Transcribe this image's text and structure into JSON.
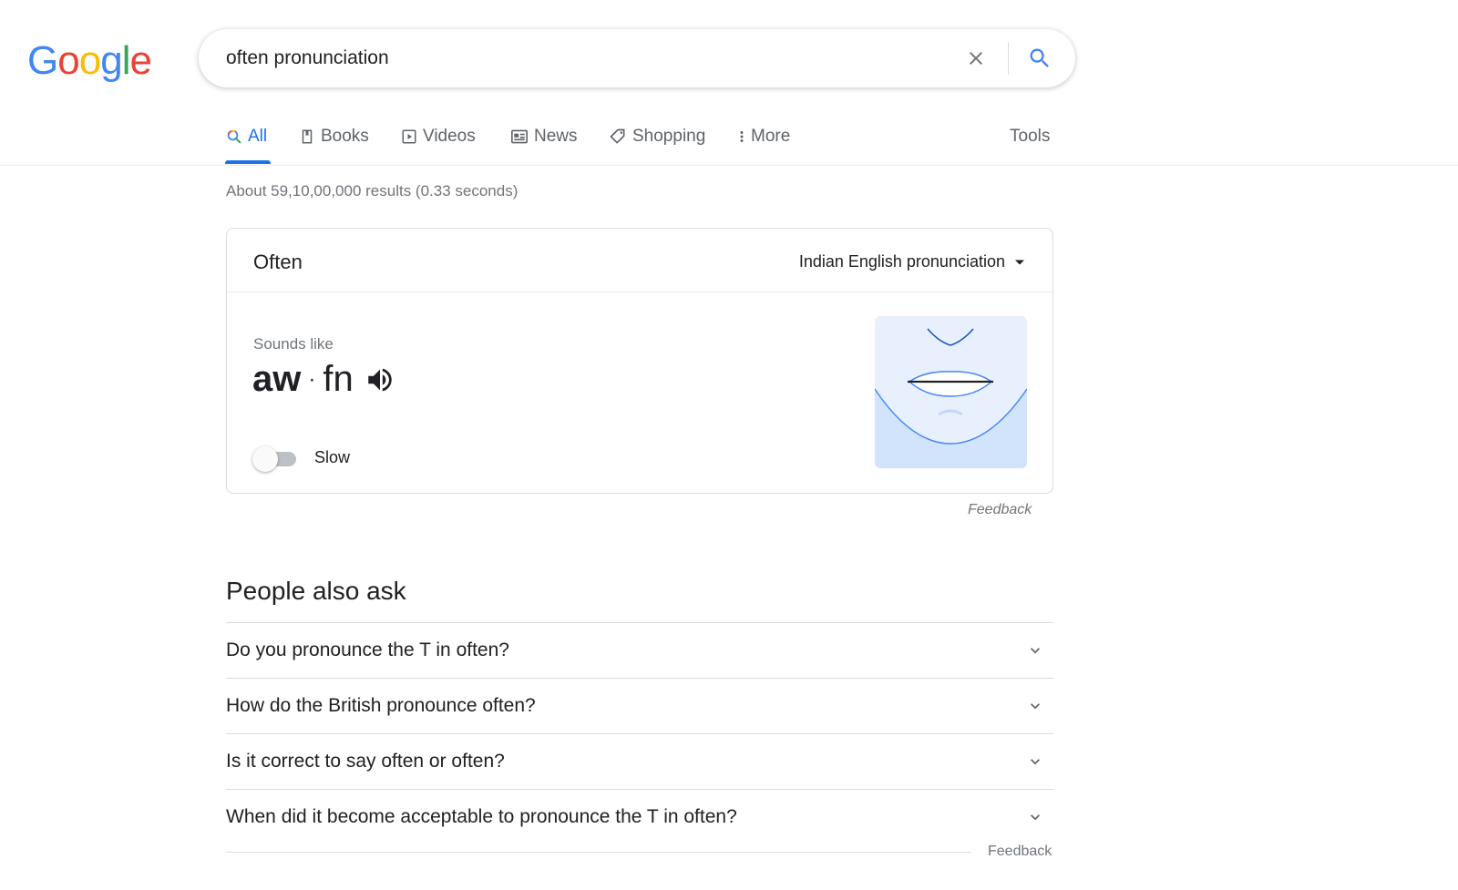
{
  "logo": {
    "letters": [
      "G",
      "o",
      "o",
      "g",
      "l",
      "e"
    ],
    "colors": [
      "#4285f4",
      "#ea4335",
      "#fbbc05",
      "#4285f4",
      "#34a853",
      "#ea4335"
    ]
  },
  "search": {
    "value": "often pronunciation",
    "clear_icon": "close-icon",
    "search_icon": "search-icon"
  },
  "tabs": [
    {
      "label": "All",
      "icon": "search-icon",
      "active": true
    },
    {
      "label": "Books",
      "icon": "book-icon"
    },
    {
      "label": "Videos",
      "icon": "video-icon"
    },
    {
      "label": "News",
      "icon": "news-icon"
    },
    {
      "label": "Shopping",
      "icon": "tag-icon"
    },
    {
      "label": "More",
      "icon": "more-vert-icon"
    }
  ],
  "tools_label": "Tools",
  "result_stats": "About 59,10,00,000 results (0.33 seconds)",
  "pronunciation": {
    "word": "Often",
    "dialect": "Indian English pronunciation",
    "sounds_like_label": "Sounds like",
    "syllable_1": "aw",
    "separator": "·",
    "syllable_2": "fn",
    "slow_label": "Slow",
    "slow_enabled": false
  },
  "feedback_label": "Feedback",
  "people_also_ask": {
    "title": "People also ask",
    "questions": [
      "Do you pronounce the T in often?",
      "How do the British pronounce often?",
      "Is it correct to say often or often?",
      "When did it become acceptable to pronounce the T in often?"
    ],
    "feedback_label": "Feedback"
  },
  "colors": {
    "accent": "#1a73e8",
    "muted_text": "#70757a",
    "border": "#dadce0",
    "mouth_bg": "#e8f0fe"
  }
}
